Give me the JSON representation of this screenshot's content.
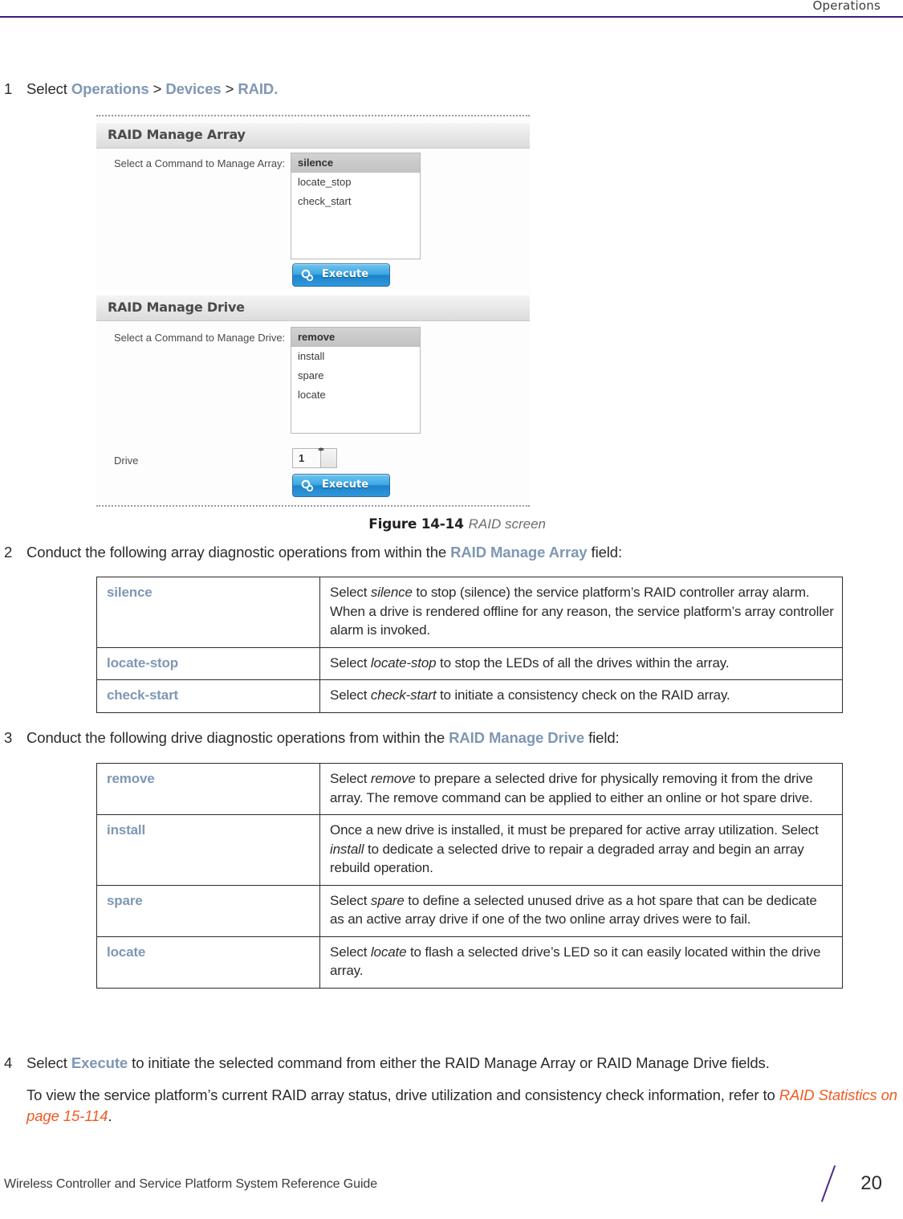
{
  "header": {
    "chapter_title": "Operations",
    "rule_color": "#3b1a78"
  },
  "steps": {
    "step1": {
      "num": "1",
      "lead": "Select ",
      "nav1": "Operations",
      "sep1": " > ",
      "nav2": "Devices",
      "sep2": " > ",
      "nav3": "RAID."
    },
    "step2": {
      "num": "2",
      "pre": "Conduct the following array diagnostic operations from within the ",
      "bold": "RAID Manage Array",
      "post": " field:"
    },
    "step3": {
      "num": "3",
      "pre": "Conduct the following drive diagnostic operations from within the ",
      "bold": "RAID Manage Drive",
      "post": " field:"
    },
    "step4": {
      "num": "4",
      "pre": "Select ",
      "bold": "Execute",
      "post": " to initiate the selected command from either the RAID Manage Array or RAID Manage Drive fields.",
      "note_pre": "To view the service platform’s current RAID array status, drive utilization and consistency check information, refer to ",
      "note_link": "RAID Statistics on page 15-114",
      "note_post": "."
    }
  },
  "figure": {
    "caption_number": "Figure 14-14",
    "caption_title": "RAID screen",
    "manage_array": {
      "panel_title": "RAID Manage Array",
      "field_label": "Select a Command to Manage Array:",
      "options": [
        "silence",
        "locate_stop",
        "check_start"
      ],
      "selected": "silence",
      "execute_label": "Execute"
    },
    "manage_drive": {
      "panel_title": "RAID Manage Drive",
      "field_label": "Select a Command to Manage Drive:",
      "options": [
        "remove",
        "install",
        "spare",
        "locate"
      ],
      "selected": "remove",
      "drive_label": "Drive",
      "drive_value": "1",
      "execute_label": "Execute"
    }
  },
  "table_array": {
    "rows": [
      {
        "key": "silence",
        "seg1": "Select ",
        "italic": "silence",
        "seg2": " to stop (silence) the service platform’s RAID controller array alarm. When a drive is rendered offline for any reason, the service platform’s array controller alarm is invoked."
      },
      {
        "key": "locate-stop",
        "seg1": "Select ",
        "italic": "locate-stop",
        "seg2": " to stop the LEDs of all the drives within the array."
      },
      {
        "key": "check-start",
        "seg1": "Select ",
        "italic": "check-start",
        "seg2": " to initiate a consistency check on the RAID array."
      }
    ]
  },
  "table_drive": {
    "rows": [
      {
        "key": "remove",
        "seg1": "Select ",
        "italic": "remove",
        "seg2": " to prepare a selected drive for physically removing it from the drive array. The remove command can be applied to either an online or hot spare drive."
      },
      {
        "key": "install",
        "seg1": "Once a new drive is installed, it must be prepared for active array utilization. Select ",
        "italic": "install",
        "seg2": " to dedicate a selected drive to repair a degraded array and begin an array rebuild operation."
      },
      {
        "key": "spare",
        "seg1": "Select ",
        "italic": "spare",
        "seg2": " to define a selected unused drive as a hot spare that can be dedicate as an active array drive if one of the two online array drives were to fail."
      },
      {
        "key": "locate",
        "seg1": "Select ",
        "italic": "locate",
        "seg2": " to flash a selected drive’s LED so it can easily located within the drive array."
      }
    ]
  },
  "footer": {
    "guide_title": "Wireless Controller and Service Platform System Reference Guide",
    "page_number": "20"
  }
}
